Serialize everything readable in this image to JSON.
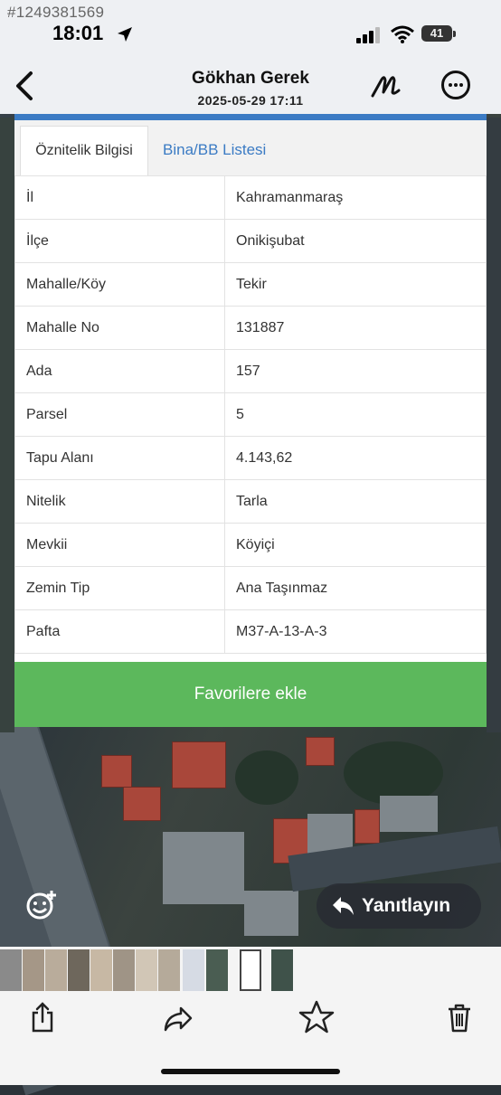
{
  "watermark": "#1249381569",
  "status_bar": {
    "time": "18:01",
    "battery": "41"
  },
  "header": {
    "title": "Gökhan Gerek",
    "subtitle": "2025-05-29 17:11"
  },
  "tabs": [
    {
      "label": "Öznitelik Bilgisi",
      "active": true
    },
    {
      "label": "Bina/BB Listesi",
      "active": false
    }
  ],
  "attributes": [
    {
      "key": "İl",
      "value": "Kahramanmaraş"
    },
    {
      "key": "İlçe",
      "value": "Onikişubat"
    },
    {
      "key": "Mahalle/Köy",
      "value": "Tekir"
    },
    {
      "key": "Mahalle No",
      "value": "131887"
    },
    {
      "key": "Ada",
      "value": "157"
    },
    {
      "key": "Parsel",
      "value": "5"
    },
    {
      "key": "Tapu Alanı",
      "value": "4.143,62"
    },
    {
      "key": "Nitelik",
      "value": "Tarla"
    },
    {
      "key": "Mevkii",
      "value": "Köyiçi"
    },
    {
      "key": "Zemin Tip",
      "value": "Ana Taşınmaz"
    },
    {
      "key": "Pafta",
      "value": "M37-A-13-A-3"
    }
  ],
  "favorite_button": "Favorilere ekle",
  "reply_button": "Yanıtlayın",
  "colors": {
    "accent_blue": "#3b7bc4",
    "green_button": "#5cb85c"
  },
  "toolbar_icons": [
    "share-icon",
    "forward-icon",
    "star-icon",
    "trash-icon"
  ]
}
